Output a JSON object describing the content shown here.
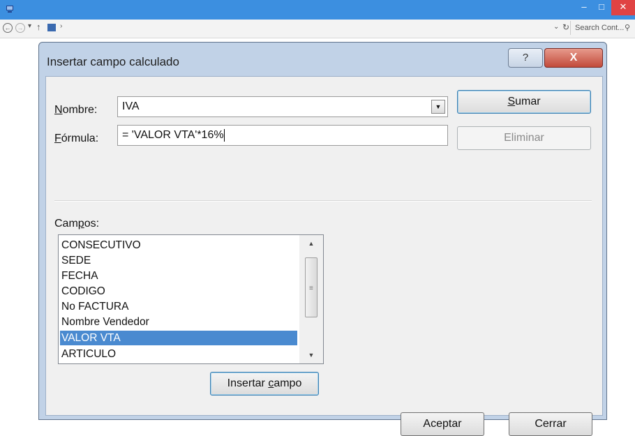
{
  "window": {
    "search_placeholder": "Search Cont...",
    "controls": {
      "minimize": "–",
      "maximize": "□",
      "close": "✕"
    }
  },
  "dialog": {
    "title": "Insertar campo calculado",
    "help_label": "?",
    "close_label": "X",
    "nombre_label": "Nombre:",
    "nombre_value": "IVA",
    "formula_label": "Fórmula:",
    "formula_value": "= 'VALOR VTA'*16%",
    "sumar_label": "Sumar",
    "eliminar_label": "Eliminar",
    "campos_label": "Campos:",
    "campos": [
      "CONSECUTIVO",
      "SEDE",
      "FECHA",
      "CODIGO",
      "No FACTURA",
      "Nombre Vendedor",
      "VALOR VTA",
      "ARTICULO"
    ],
    "selected_campo": "VALOR VTA",
    "insertar_campo_label": "Insertar campo",
    "aceptar_label": "Aceptar",
    "cerrar_label": "Cerrar"
  },
  "colors": {
    "titlebar": "#3c8fe0",
    "dialog_frame": "#c1d2e7",
    "selection": "#4a8ad0",
    "close_button": "#c24a3a"
  }
}
